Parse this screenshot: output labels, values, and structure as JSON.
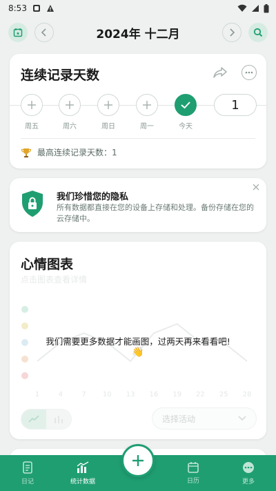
{
  "status_bar": {
    "time": "8:53"
  },
  "header": {
    "month_title": "2024年 十二月"
  },
  "streak": {
    "title": "连续记录天数",
    "days": [
      {
        "label": "周五",
        "done": false
      },
      {
        "label": "周六",
        "done": false
      },
      {
        "label": "周日",
        "done": false
      },
      {
        "label": "周一",
        "done": false
      },
      {
        "label": "今天",
        "done": true
      }
    ],
    "count": "1",
    "best_label": "最高连续记录天数：1"
  },
  "privacy": {
    "title": "我们珍惜您的隐私",
    "text": "所有数据都直接在您的设备上存储和处理。备份存储在您的云存储中。"
  },
  "mood_chart": {
    "title": "心情图表",
    "subtitle": "点击图表查看详情",
    "message": "我们需要更多数据才能画图，过两天再来看看吧!",
    "emoji": "👋",
    "x_ticks": [
      "1",
      "4",
      "7",
      "10",
      "13",
      "16",
      "19",
      "22",
      "25",
      "28"
    ],
    "select_placeholder": "选择活动"
  },
  "chart_data": {
    "type": "line",
    "title": "心情图表",
    "x": [
      1,
      4,
      7,
      10,
      13,
      16,
      19,
      22,
      25,
      28
    ],
    "series": [
      {
        "values": [
          2,
          3,
          3.5,
          3,
          2,
          3.5,
          4,
          3,
          3,
          2
        ]
      }
    ],
    "ylim": [
      1,
      5
    ],
    "grid": false,
    "note_visible": "placeholder (faded) data"
  },
  "colors": {
    "accent": "#1f9e72",
    "background": "#eef1f0"
  },
  "nav": {
    "items": [
      {
        "label": "日记",
        "icon": "journal-icon"
      },
      {
        "label": "统计数据",
        "icon": "stats-icon"
      },
      {
        "label": "日历",
        "icon": "calendar-icon"
      },
      {
        "label": "更多",
        "icon": "more-icon"
      }
    ]
  }
}
